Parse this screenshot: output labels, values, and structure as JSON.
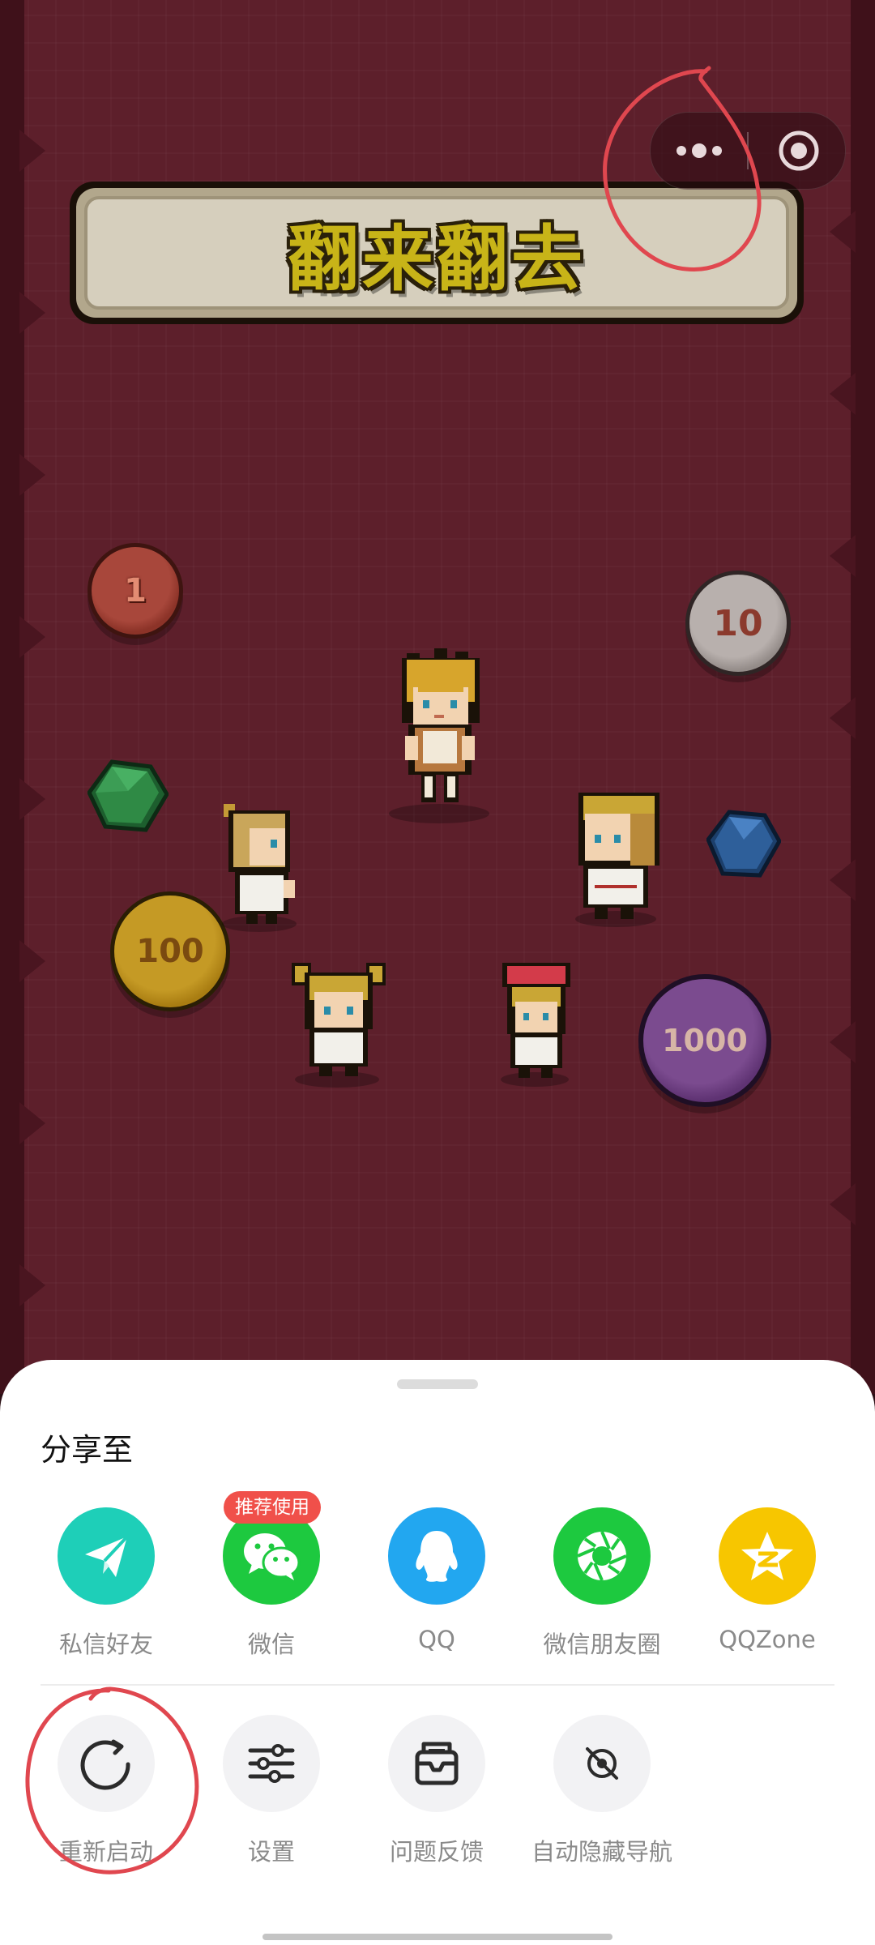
{
  "game": {
    "title": "翻来翻去",
    "coins": [
      {
        "id": "coin-1",
        "label": "1",
        "color": "#a8473b"
      },
      {
        "id": "coin-10",
        "label": "10",
        "color": "#b8b0ad"
      },
      {
        "id": "coin-100",
        "label": "100",
        "color": "#c59a25"
      },
      {
        "id": "coin-1000",
        "label": "1000",
        "color": "#7b4b8f"
      }
    ],
    "gems": [
      {
        "id": "gem-green",
        "color": "#2f8a45"
      },
      {
        "id": "gem-blue",
        "color": "#2e5f9a"
      }
    ],
    "background_color": "#5d1f2b"
  },
  "capsule": {
    "more_icon": "more-dots-icon",
    "close_icon": "target-close-icon"
  },
  "share_sheet": {
    "title": "分享至",
    "recommend_badge": "推荐使用",
    "share_targets": [
      {
        "label": "私信好友",
        "icon": "paper-plane-icon",
        "color": "#1ecfb8"
      },
      {
        "label": "微信",
        "icon": "wechat-icon",
        "color": "#1dc93f"
      },
      {
        "label": "QQ",
        "icon": "qq-penguin-icon",
        "color": "#22a7f0"
      },
      {
        "label": "微信朋友圈",
        "icon": "moments-aperture-icon",
        "color": "#1dc93f"
      },
      {
        "label": "QQZone",
        "icon": "qzone-star-icon",
        "color": "#f7c600"
      }
    ],
    "actions": [
      {
        "label": "重新启动",
        "icon": "restart-icon"
      },
      {
        "label": "设置",
        "icon": "settings-sliders-icon"
      },
      {
        "label": "问题反馈",
        "icon": "feedback-inbox-icon"
      },
      {
        "label": "自动隐藏导航",
        "icon": "hide-navigation-icon"
      }
    ]
  },
  "annotation_color": "#e0474f"
}
